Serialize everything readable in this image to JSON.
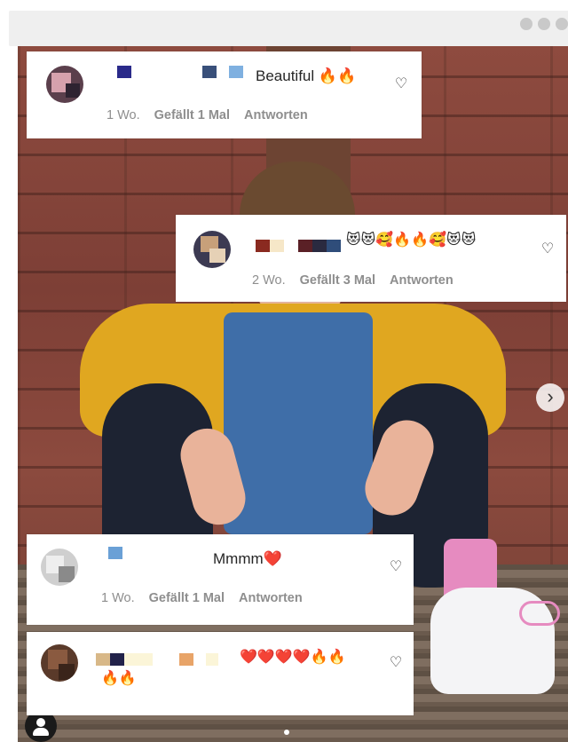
{
  "window": {
    "icons": {
      "more": "more-dots-icon"
    }
  },
  "comments": [
    {
      "text": "Beautiful 🔥🔥",
      "age": "1 Wo.",
      "likes": "Gefällt 1 Mal",
      "reply": "Antworten"
    },
    {
      "text": "😻😻🥰🔥🔥🥰😻😻",
      "age": "2 Wo.",
      "likes": "Gefällt 3 Mal",
      "reply": "Antworten"
    },
    {
      "text": "Mmmm❤️",
      "age": "1 Wo.",
      "likes": "Gefällt 1 Mal",
      "reply": "Antworten"
    },
    {
      "text": "❤️❤️❤️❤️🔥🔥",
      "text2": "🔥🔥"
    }
  ],
  "icons": {
    "like": "heart-icon",
    "next": "chevron-right-icon",
    "tag": "user-tag-icon"
  },
  "colors": {
    "meta": "#8e8e8e",
    "text": "#262626"
  }
}
